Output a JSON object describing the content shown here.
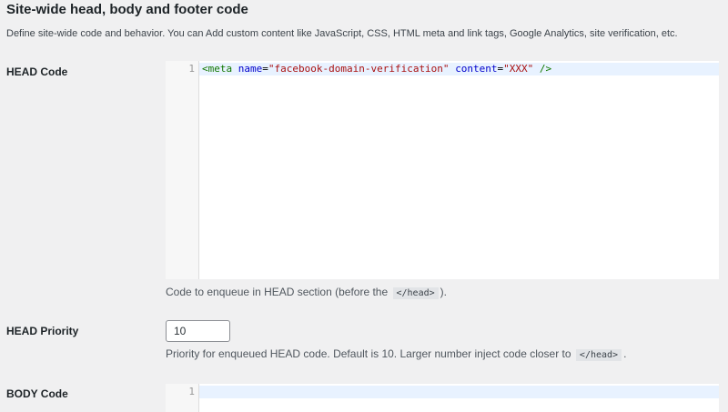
{
  "section": {
    "title": "Site-wide head, body and footer code",
    "description": "Define site-wide code and behavior. You can Add custom content like JavaScript, CSS, HTML meta and link tags, Google Analytics, site verification, etc."
  },
  "head_code": {
    "label": "HEAD Code",
    "line_number": "1",
    "tokens": {
      "open": "<meta",
      "attr1": "name",
      "eq1": "=",
      "val1": "\"facebook-domain-verification\"",
      "attr2": "content",
      "eq2": "=",
      "val2": "\"XXX\"",
      "close": "/>"
    },
    "help_before": "Code to enqueue in HEAD section (before the",
    "help_code": "</head>",
    "help_after": ")."
  },
  "head_priority": {
    "label": "HEAD Priority",
    "value": "10",
    "help_before": "Priority for enqueued HEAD code. Default is 10. Larger number inject code closer to",
    "help_code": "</head>",
    "help_after": "."
  },
  "body_code": {
    "label": "BODY Code",
    "line_number": "1"
  }
}
